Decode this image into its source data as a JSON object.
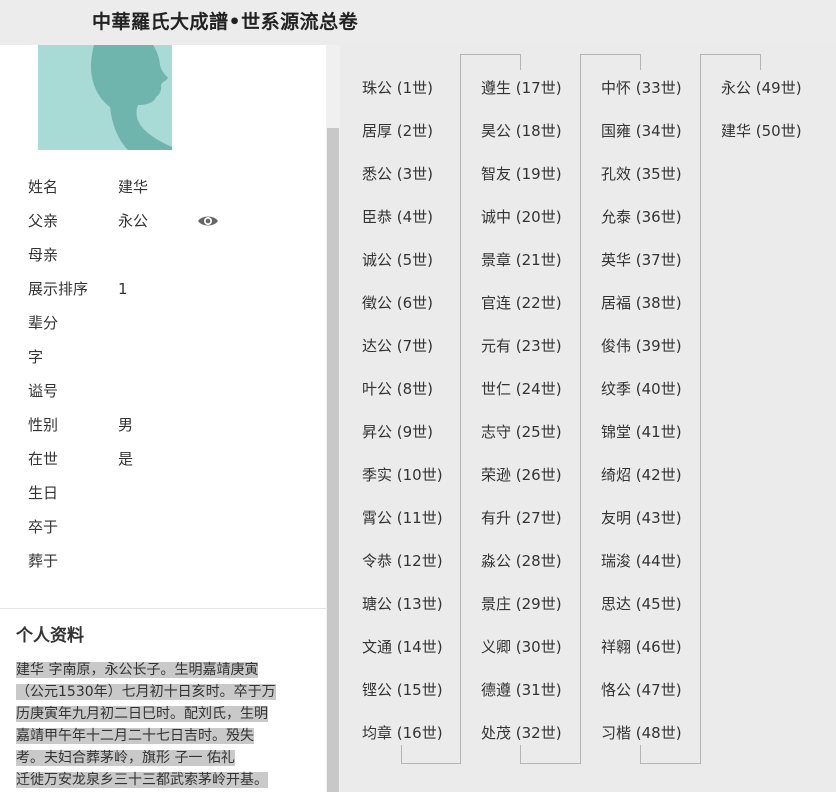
{
  "header": {
    "title": "中華羅氏大成譜•世系源流总卷"
  },
  "profile": {
    "fields": [
      {
        "label": "姓名",
        "value": "建华"
      },
      {
        "label": "父亲",
        "value": "永公"
      },
      {
        "label": "母亲",
        "value": ""
      },
      {
        "label": "展示排序",
        "value": "1"
      },
      {
        "label": "辈分",
        "value": ""
      },
      {
        "label": "字",
        "value": ""
      },
      {
        "label": "谥号",
        "value": ""
      },
      {
        "label": "性别",
        "value": "男"
      },
      {
        "label": "在世",
        "value": "是"
      },
      {
        "label": "生日",
        "value": ""
      },
      {
        "label": "卒于",
        "value": ""
      },
      {
        "label": "葬于",
        "value": ""
      }
    ],
    "father_view_icon": "eye-icon",
    "avatar_icon": "person-silhouette-icon"
  },
  "bio": {
    "title": "个人资料",
    "lines": [
      "建华  字南原，永公长子。生明嘉靖庚寅",
      "（公元1530年）七月初十日亥时。卒于万",
      "历庚寅年九月初二日巳时。配刘氏，生明",
      "嘉靖甲午年十二月二十七日吉时。殁失",
      "考。夫妇合葬茅岭，旗形  子一  佑礼",
      "迁徙万安龙泉乡三十三都武索茅岭开基。"
    ]
  },
  "generations": [
    [
      "珠公 (1世)",
      "居厚 (2世)",
      "悉公 (3世)",
      "臣恭 (4世)",
      "诚公 (5世)",
      "徵公 (6世)",
      "达公 (7世)",
      "叶公 (8世)",
      "昇公 (9世)",
      "季实 (10世)",
      "霄公 (11世)",
      "令恭 (12世)",
      "瑭公 (13世)",
      "文通 (14世)",
      "铿公 (15世)",
      "均章 (16世)"
    ],
    [
      "遵生 (17世)",
      "昊公 (18世)",
      "智友 (19世)",
      "诚中 (20世)",
      "景章 (21世)",
      "官连 (22世)",
      "元有 (23世)",
      "世仁 (24世)",
      "志守 (25世)",
      "荣逊 (26世)",
      "有升 (27世)",
      "淼公 (28世)",
      "景庄 (29世)",
      "义卿 (30世)",
      "德遵 (31世)",
      "处茂 (32世)"
    ],
    [
      "中怀 (33世)",
      "国雍 (34世)",
      "孔效 (35世)",
      "允泰 (36世)",
      "英华 (37世)",
      "居福 (38世)",
      "俊伟 (39世)",
      "纹季 (40世)",
      "锦堂 (41世)",
      "绮炤 (42世)",
      "友明 (43世)",
      "瑞浚 (44世)",
      "思达 (45世)",
      "祥翱 (46世)",
      "恪公 (47世)",
      "习楷 (48世)"
    ],
    [
      "永公 (49世)",
      "建华 (50世)"
    ]
  ]
}
